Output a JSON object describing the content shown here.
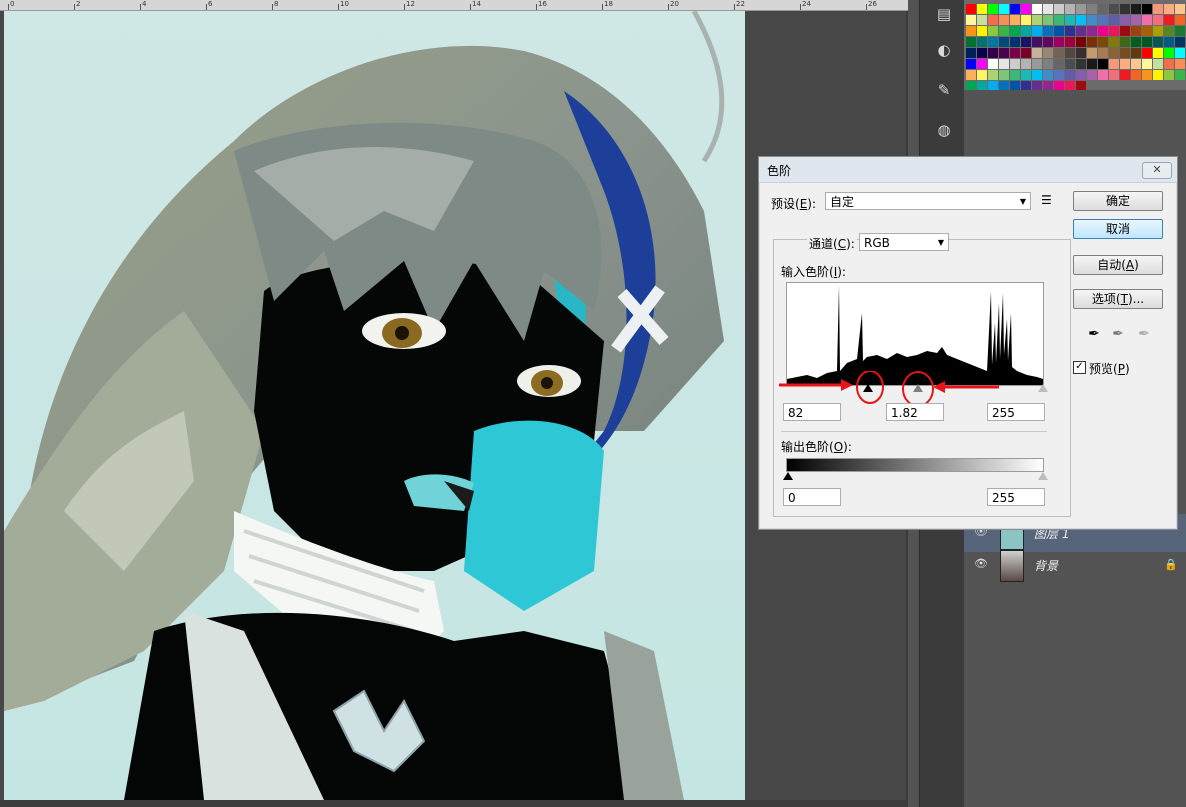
{
  "ruler": {
    "ticks": [
      "0",
      "2",
      "4",
      "6",
      "8",
      "10",
      "12",
      "14",
      "16",
      "18",
      "20",
      "22",
      "24",
      "26"
    ]
  },
  "layers": {
    "rows": [
      {
        "name": "图层 1",
        "locked": false
      },
      {
        "name": "背景",
        "locked": true
      }
    ]
  },
  "dialog": {
    "title": "色阶",
    "close_glyph": "✕",
    "preset_label": "预设(",
    "preset_key": "E",
    "preset_suffix": "):",
    "preset_value": "自定",
    "channel_label": "通道(",
    "channel_key": "C",
    "channel_suffix": "):",
    "channel_value": "RGB",
    "input_levels_label": "输入色阶(",
    "input_levels_key": "I",
    "input_levels_suffix": "):",
    "input_black": "82",
    "input_gamma": "1.82",
    "input_white": "255",
    "output_levels_label": "输出色阶(",
    "output_levels_key": "O",
    "output_levels_suffix": "):",
    "output_black": "0",
    "output_white": "255",
    "ok_label": "确定",
    "cancel_label": "取消",
    "auto_label": "自动(",
    "auto_key": "A",
    "auto_suffix": ")",
    "options_label": "选项(",
    "options_key": "T",
    "options_suffix": ")...",
    "preview_label": "预览(",
    "preview_key": "P",
    "preview_suffix": ")",
    "preview_checked": true
  },
  "colors": {
    "annotation_red": "#e8141b",
    "cancel_focus": "#3c7fb1"
  }
}
